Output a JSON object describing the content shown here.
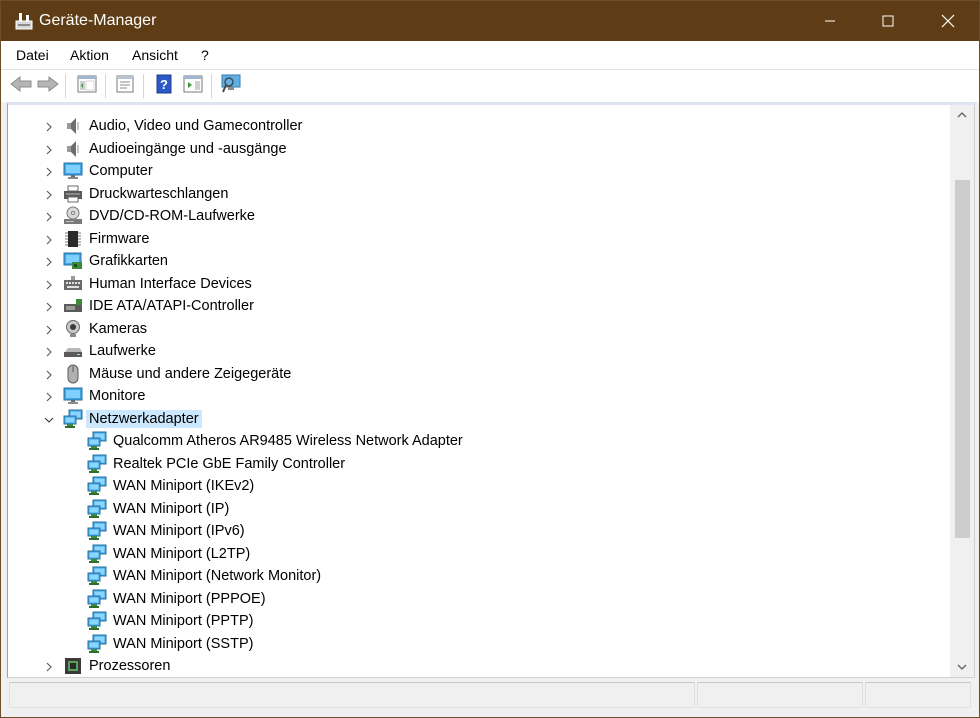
{
  "window": {
    "title": "Geräte-Manager",
    "title_bar_color": "#5e3d16",
    "controls": {
      "minimize": "minimize-icon",
      "maximize": "maximize-icon",
      "close": "close-icon"
    }
  },
  "menu": {
    "items": [
      {
        "label": "Datei"
      },
      {
        "label": "Aktion"
      },
      {
        "label": "Ansicht"
      },
      {
        "label": "?"
      }
    ]
  },
  "toolbar": {
    "buttons": [
      {
        "name": "back-icon"
      },
      {
        "name": "forward-icon"
      },
      {
        "name": "show-hide-console-tree-icon"
      },
      {
        "name": "properties-icon"
      },
      {
        "name": "help-icon"
      },
      {
        "name": "action-pane-icon"
      },
      {
        "name": "scan-hardware-icon"
      }
    ]
  },
  "tree": {
    "selection_color": "#cce8ff",
    "nodes": [
      {
        "label": "Audio, Video und Gamecontroller",
        "icon": "speaker-icon",
        "expanded": false
      },
      {
        "label": "Audioeingänge und -ausgänge",
        "icon": "speaker-icon",
        "expanded": false
      },
      {
        "label": "Computer",
        "icon": "monitor-icon",
        "expanded": false
      },
      {
        "label": "Druckwarteschlangen",
        "icon": "printer-icon",
        "expanded": false
      },
      {
        "label": "DVD/CD-ROM-Laufwerke",
        "icon": "optical-drive-icon",
        "expanded": false
      },
      {
        "label": "Firmware",
        "icon": "chip-icon",
        "expanded": false
      },
      {
        "label": "Grafikkarten",
        "icon": "display-adapter-icon",
        "expanded": false
      },
      {
        "label": "Human Interface Devices",
        "icon": "keyboard-icon",
        "expanded": false
      },
      {
        "label": "IDE ATA/ATAPI-Controller",
        "icon": "controller-icon",
        "expanded": false
      },
      {
        "label": "Kameras",
        "icon": "webcam-icon",
        "expanded": false
      },
      {
        "label": "Laufwerke",
        "icon": "disk-drive-icon",
        "expanded": false
      },
      {
        "label": "Mäuse und andere Zeigegeräte",
        "icon": "mouse-icon",
        "expanded": false
      },
      {
        "label": "Monitore",
        "icon": "monitor-icon",
        "expanded": false
      },
      {
        "label": "Netzwerkadapter",
        "icon": "network-adapter-icon",
        "expanded": true,
        "selected": true,
        "children": [
          {
            "label": "Qualcomm Atheros AR9485 Wireless Network Adapter",
            "icon": "network-adapter-icon"
          },
          {
            "label": "Realtek PCIe GbE Family Controller",
            "icon": "network-adapter-icon"
          },
          {
            "label": "WAN Miniport (IKEv2)",
            "icon": "network-adapter-icon"
          },
          {
            "label": "WAN Miniport (IP)",
            "icon": "network-adapter-icon"
          },
          {
            "label": "WAN Miniport (IPv6)",
            "icon": "network-adapter-icon"
          },
          {
            "label": "WAN Miniport (L2TP)",
            "icon": "network-adapter-icon"
          },
          {
            "label": "WAN Miniport (Network Monitor)",
            "icon": "network-adapter-icon"
          },
          {
            "label": "WAN Miniport (PPPOE)",
            "icon": "network-adapter-icon"
          },
          {
            "label": "WAN Miniport (PPTP)",
            "icon": "network-adapter-icon"
          },
          {
            "label": "WAN Miniport (SSTP)",
            "icon": "network-adapter-icon"
          }
        ]
      },
      {
        "label": "Prozessoren",
        "icon": "processor-icon",
        "expanded": false
      }
    ]
  }
}
